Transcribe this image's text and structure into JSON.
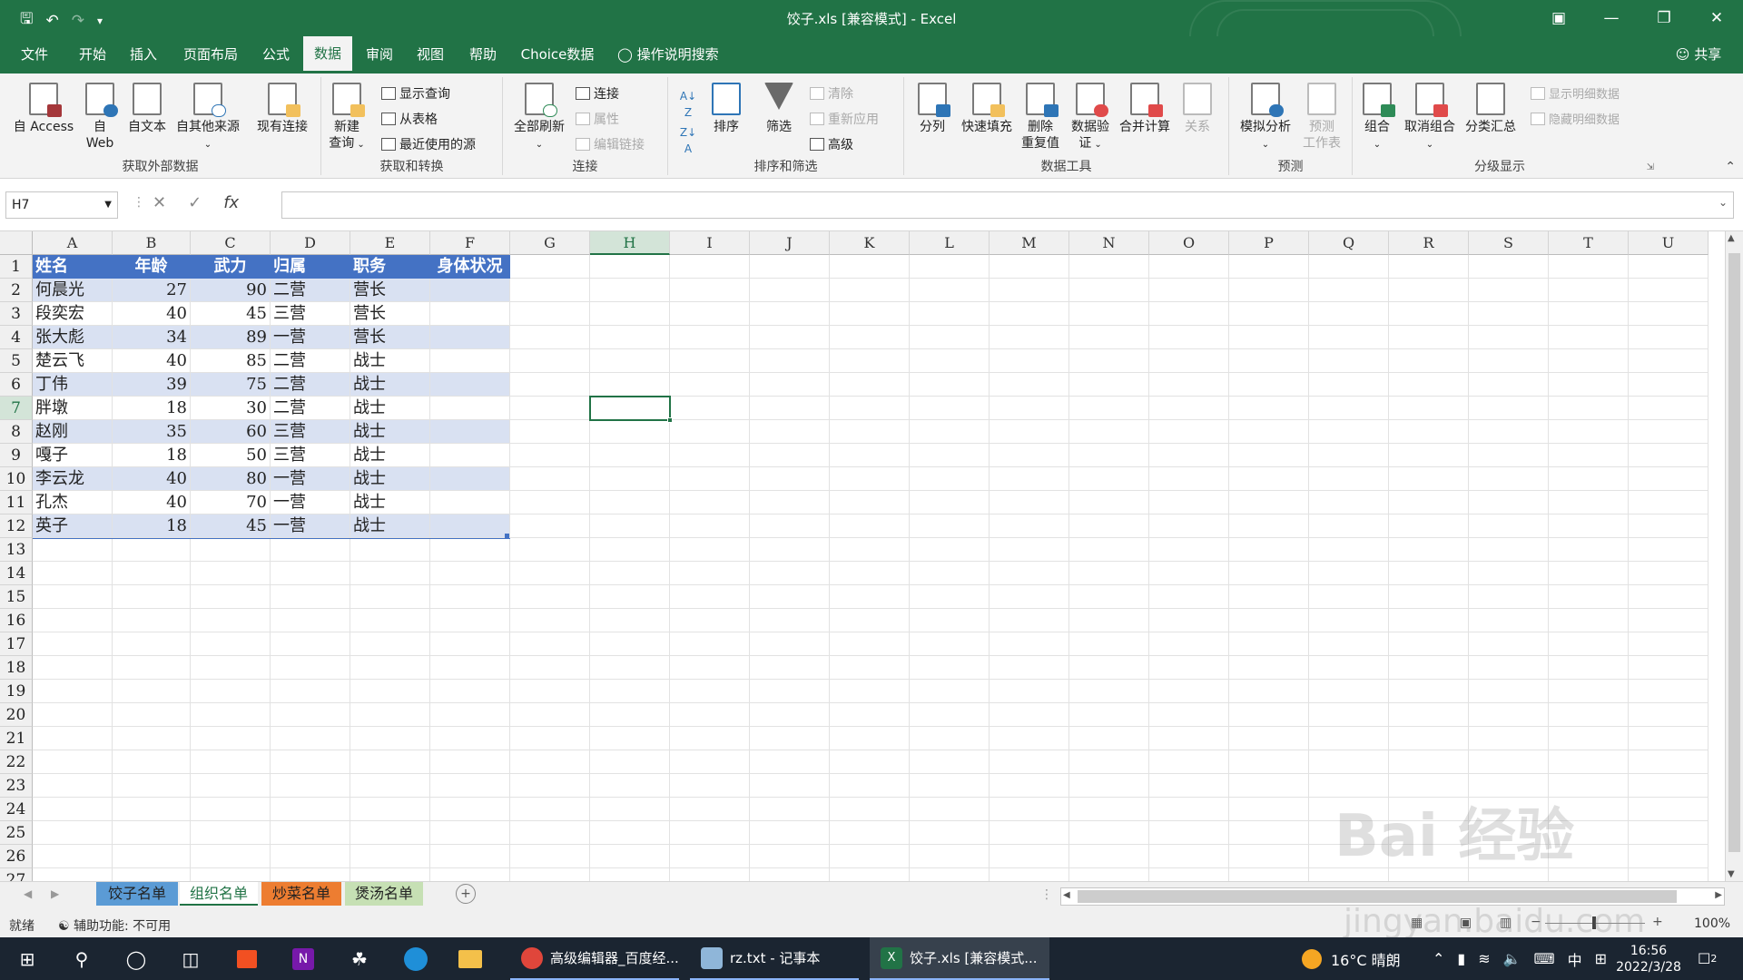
{
  "window": {
    "title": "饺子.xls  [兼容模式]  -  Excel",
    "share": "共享"
  },
  "ribbon_tabs": [
    "文件",
    "开始",
    "插入",
    "页面布局",
    "公式",
    "数据",
    "审阅",
    "视图",
    "帮助",
    "Choice数据"
  ],
  "tell_me": "操作说明搜索",
  "ribbon": {
    "get_external": {
      "title": "获取外部数据",
      "access": "自 Access",
      "web_1": "自",
      "web_2": "Web",
      "text": "自文本",
      "other": "自其他来源",
      "existing": "现有连接"
    },
    "get_transform": {
      "title": "获取和转换",
      "new_query_1": "新建",
      "new_query_2": "查询",
      "show_queries": "显示查询",
      "from_table": "从表格",
      "recent_sources": "最近使用的源"
    },
    "connections": {
      "title": "连接",
      "refresh_all": "全部刷新",
      "connections": "连接",
      "properties": "属性",
      "edit_links": "编辑链接"
    },
    "sort_filter": {
      "title": "排序和筛选",
      "sort": "排序",
      "filter": "筛选",
      "clear": "清除",
      "reapply": "重新应用",
      "advanced": "高级"
    },
    "data_tools": {
      "title": "数据工具",
      "split": "分列",
      "flash_fill": "快速填充",
      "remove_dup_1": "删除",
      "remove_dup_2": "重复值",
      "validation_1": "数据验",
      "validation_2": "证",
      "consolidate": "合并计算",
      "relationships": "关系"
    },
    "forecast": {
      "title": "预测",
      "whatif": "模拟分析",
      "sheet_1": "预测",
      "sheet_2": "工作表"
    },
    "outline": {
      "title": "分级显示",
      "group": "组合",
      "ungroup": "取消组合",
      "subtotal": "分类汇总",
      "show_detail": "显示明细数据",
      "hide_detail": "隐藏明细数据"
    }
  },
  "formula_bar": {
    "name_box": "H7",
    "fx": "fx",
    "content": ""
  },
  "columns": [
    "A",
    "B",
    "C",
    "D",
    "E",
    "F",
    "G",
    "H",
    "I",
    "J",
    "K",
    "L",
    "M",
    "N",
    "O",
    "P",
    "Q",
    "R",
    "S",
    "T",
    "U"
  ],
  "rows": [
    "1",
    "2",
    "3",
    "4",
    "5",
    "6",
    "7",
    "8",
    "9",
    "10",
    "11",
    "12",
    "13",
    "14",
    "15",
    "16",
    "17",
    "18",
    "19",
    "20",
    "21",
    "22",
    "23",
    "24",
    "25",
    "26",
    "27"
  ],
  "table": {
    "headers": [
      "姓名",
      "年龄",
      "武力",
      "归属",
      "职务",
      "身体状况"
    ],
    "rows": [
      [
        "何晨光",
        "27",
        "90",
        "二营",
        "营长",
        ""
      ],
      [
        "段奕宏",
        "40",
        "45",
        "三营",
        "营长",
        ""
      ],
      [
        "张大彪",
        "34",
        "89",
        "一营",
        "营长",
        ""
      ],
      [
        "楚云飞",
        "40",
        "85",
        "二营",
        "战士",
        ""
      ],
      [
        "丁伟",
        "39",
        "75",
        "二营",
        "战士",
        ""
      ],
      [
        "胖墩",
        "18",
        "30",
        "二营",
        "战士",
        ""
      ],
      [
        "赵刚",
        "35",
        "60",
        "三营",
        "战士",
        ""
      ],
      [
        "嘎子",
        "18",
        "50",
        "三营",
        "战士",
        ""
      ],
      [
        "李云龙",
        "40",
        "80",
        "一营",
        "战士",
        ""
      ],
      [
        "孔杰",
        "40",
        "70",
        "一营",
        "战士",
        ""
      ],
      [
        "英子",
        "18",
        "45",
        "一营",
        "战士",
        ""
      ]
    ]
  },
  "sheets": [
    {
      "name": "饺子名单",
      "color": "#5b9bd5"
    },
    {
      "name": "组织名单",
      "color": "#ffffff"
    },
    {
      "name": "炒菜名单",
      "color": "#ed7d31"
    },
    {
      "name": "煲汤名单",
      "color": "#c6e0b4"
    }
  ],
  "status": {
    "ready": "就绪",
    "accessibility": "辅助功能: 不可用",
    "zoom": "100%"
  },
  "taskbar": {
    "apps": [
      "高级编辑器_百度经...",
      "rz.txt - 记事本",
      "饺子.xls  [兼容模式..."
    ],
    "weather": "16°C 晴朗",
    "ime": "中",
    "time": "16:56",
    "date": "2022/3/28",
    "notif_count": "2"
  },
  "watermark": {
    "main": "Bai 经验",
    "sub": "jingyan.baidu.com"
  },
  "colors": {
    "excel_green": "#217346",
    "table_header": "#4472c4",
    "table_band": "#d9e1f2"
  }
}
